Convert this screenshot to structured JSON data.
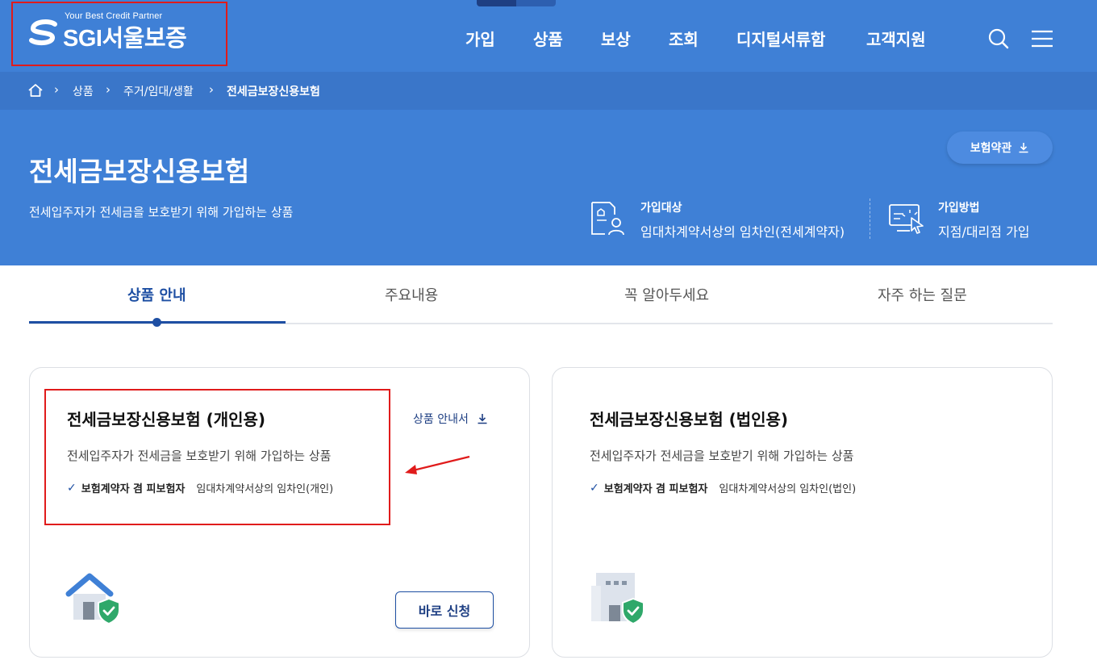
{
  "header": {
    "logo": {
      "tagline": "Your Best Credit Partner",
      "name": "SGI서울보증"
    },
    "nav": [
      "가입",
      "상품",
      "보상",
      "조회",
      "디지털서류함",
      "고객지원"
    ]
  },
  "breadcrumb": [
    "상품",
    "주거/임대/생활",
    "전세금보장신용보험"
  ],
  "hero": {
    "title": "전세금보장신용보험",
    "subtitle": "전세입주자가 전세금을 보호받기 위해 가입하는 상품",
    "terms_button": "보험약관",
    "info": [
      {
        "label": "가입대상",
        "value": "임대차계약서상의 임차인(전세계약자)"
      },
      {
        "label": "가입방법",
        "value": "지점/대리점 가입"
      }
    ]
  },
  "tabs": [
    {
      "label": "상품 안내",
      "active": true
    },
    {
      "label": "주요내용",
      "active": false
    },
    {
      "label": "꼭 알아두세요",
      "active": false
    },
    {
      "label": "자주 하는 질문",
      "active": false
    }
  ],
  "cards": [
    {
      "title": "전세금보장신용보험 (개인용)",
      "description": "전세입주자가 전세금을 보호받기 위해 가입하는 상품",
      "check_label": "보험계약자 겸 피보험자",
      "check_value": "임대차계약서상의 임차인(개인)",
      "guide_link": "상품 안내서",
      "apply_button": "바로 신청",
      "icon": "house-shield-icon"
    },
    {
      "title": "전세금보장신용보험 (법인용)",
      "description": "전세입주자가 전세금을 보호받기 위해 가입하는 상품",
      "check_label": "보험계약자 겸 피보험자",
      "check_value": "임대차계약서상의 임차인(법인)",
      "icon": "building-shield-icon"
    }
  ],
  "colors": {
    "hero_bg": "#3f80d6",
    "breadcrumb_bg": "#3a76c9",
    "accent": "#1e4fa3",
    "annotation_red": "#e01b1b",
    "shield_green": "#2fa86a"
  }
}
